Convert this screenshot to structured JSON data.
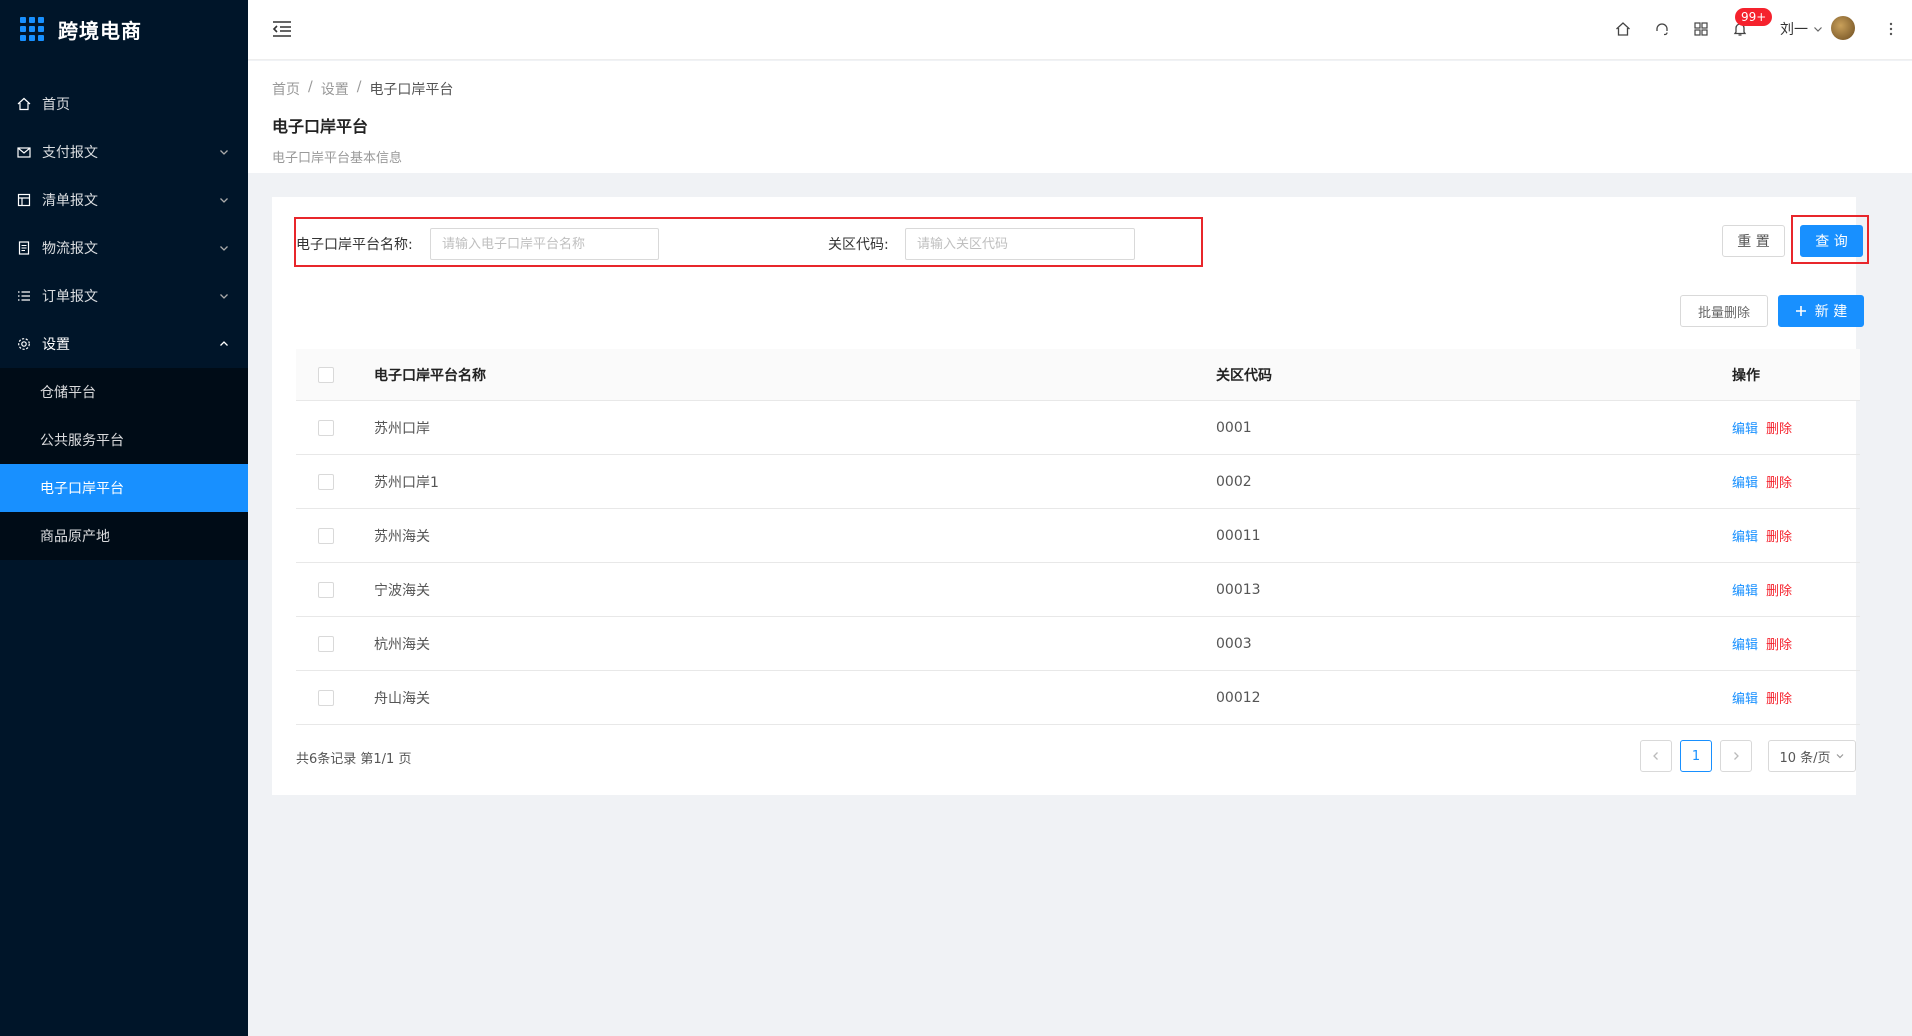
{
  "app": {
    "title": "跨境电商"
  },
  "sidebar": {
    "items": [
      {
        "label": "首页",
        "icon": "home-icon"
      },
      {
        "label": "支付报文",
        "icon": "mail-icon"
      },
      {
        "label": "清单报文",
        "icon": "list-icon"
      },
      {
        "label": "物流报文",
        "icon": "doc-icon"
      },
      {
        "label": "订单报文",
        "icon": "bullets-icon"
      },
      {
        "label": "设置",
        "icon": "gear-icon"
      }
    ],
    "submenu": [
      {
        "label": "仓储平台"
      },
      {
        "label": "公共服务平台"
      },
      {
        "label": "电子口岸平台"
      },
      {
        "label": "商品原产地"
      }
    ]
  },
  "header": {
    "badge": "99+",
    "user_name": "刘一"
  },
  "breadcrumb": [
    "首页",
    "设置",
    "电子口岸平台"
  ],
  "page": {
    "title": "电子口岸平台",
    "subtitle": "电子口岸平台基本信息"
  },
  "search": {
    "name_label": "电子口岸平台名称:",
    "name_placeholder": "请输入电子口岸平台名称",
    "code_label": "关区代码:",
    "code_placeholder": "请输入关区代码",
    "reset": "重 置",
    "query": "查 询"
  },
  "actions": {
    "batch_delete": "批量删除",
    "new": "新 建"
  },
  "table": {
    "headers": [
      "电子口岸平台名称",
      "关区代码",
      "操作"
    ],
    "rows": [
      {
        "name": "苏州口岸",
        "code": "0001"
      },
      {
        "name": "苏州口岸1",
        "code": "0002"
      },
      {
        "name": "苏州海关",
        "code": "00011"
      },
      {
        "name": "宁波海关",
        "code": "00013"
      },
      {
        "name": "杭州海关",
        "code": "0003"
      },
      {
        "name": "舟山海关",
        "code": "00012"
      }
    ],
    "edit": "编辑",
    "delete": "删除"
  },
  "pagination": {
    "total_text": "共6条记录 第1/1 页",
    "current": "1",
    "page_size": "10 条/页"
  },
  "colors": {
    "sidebar_bg": "#001529",
    "primary": "#1890ff",
    "danger": "#f5222d",
    "highlight_border": "#e8262b"
  }
}
